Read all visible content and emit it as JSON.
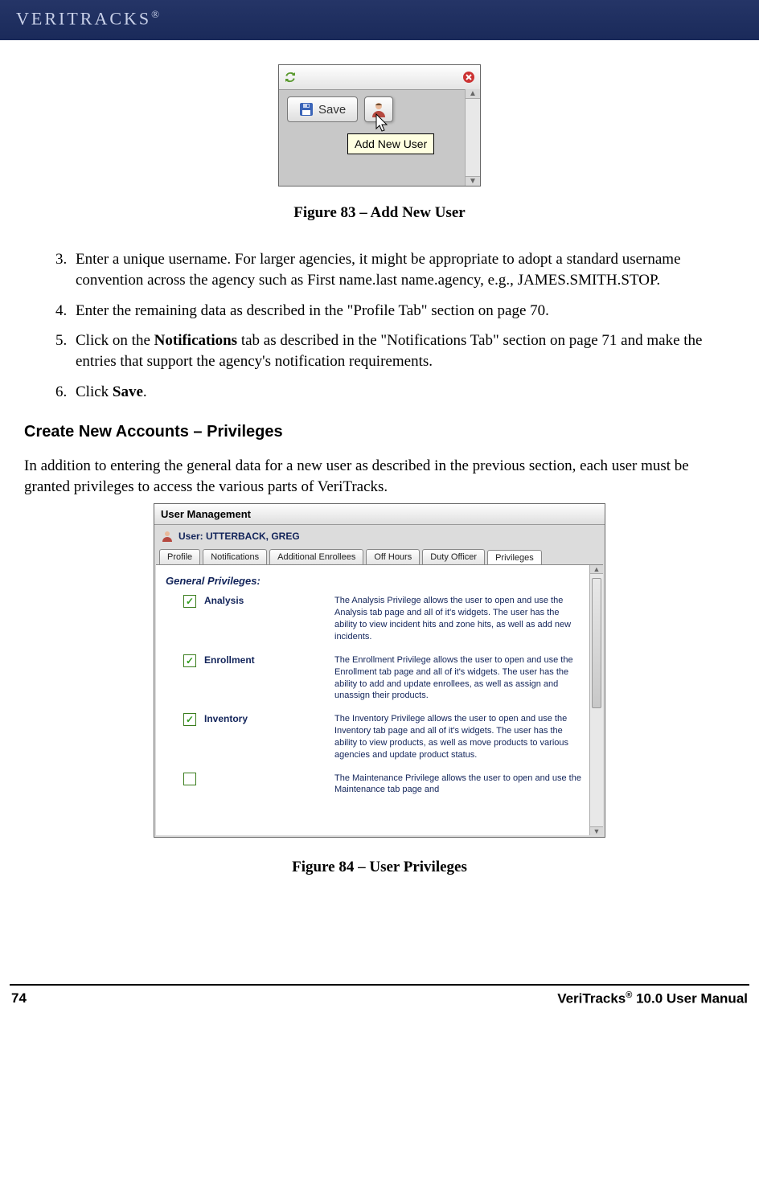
{
  "brand": {
    "name": "VERITRACKS",
    "reg": "®"
  },
  "fig1": {
    "caption": "Figure 83 – Add New User",
    "save_label": "Save",
    "tooltip": "Add New User"
  },
  "steps": {
    "start": 3,
    "items": [
      "Enter a unique username. For larger agencies, it might be appropriate to adopt a standard username convention across the agency such as First name.last name.agency, e.g., JAMES.SMITH.STOP.",
      "Enter the remaining data as described in the \"Profile Tab\" section on page 70.",
      "",
      ""
    ],
    "item5_pre": "Click on the ",
    "item5_bold": "Notifications",
    "item5_post": " tab as described in the \"Notifications Tab\" section on page 71 and make the entries that support the agency's notification requirements.",
    "item6_pre": "Click ",
    "item6_bold": "Save",
    "item6_post": "."
  },
  "section_heading": "Create New Accounts – Privileges",
  "section_intro": "In addition to entering the general data for a new user as described in the previous section, each user must be granted privileges to access the various parts of VeriTracks.",
  "fig2": {
    "panel_title": "User Management",
    "user_label_prefix": "User: ",
    "user_name": "UTTERBACK, GREG",
    "tabs": [
      "Profile",
      "Notifications",
      "Additional Enrollees",
      "Off Hours",
      "Duty Officer",
      "Privileges"
    ],
    "gp_label": "General Privileges:",
    "privs": [
      {
        "name": "Analysis",
        "checked": true,
        "desc": "The Analysis Privilege allows the user to open and use the Analysis tab page and all of it's widgets. The user has the ability to view incident hits and zone hits, as well as add new incidents."
      },
      {
        "name": "Enrollment",
        "checked": true,
        "desc": "The Enrollment Privilege allows the user to open and use the Enrollment tab page and all of it's widgets. The user has the ability to add and update enrollees, as well as assign and unassign their products."
      },
      {
        "name": "Inventory",
        "checked": true,
        "desc": "The Inventory Privilege allows the user to open and use the Inventory tab page and all of it's widgets. The user has the ability to view products, as well as move products to various agencies and update product status."
      },
      {
        "name": "",
        "checked": false,
        "desc": "The Maintenance Privilege allows the user to open and use the Maintenance tab page and"
      }
    ],
    "caption": "Figure 84 – User Privileges"
  },
  "footer": {
    "page_number": "74",
    "doc_title_pre": "VeriTracks",
    "doc_title_reg": "®",
    "doc_title_post": " 10.0 User Manual"
  }
}
